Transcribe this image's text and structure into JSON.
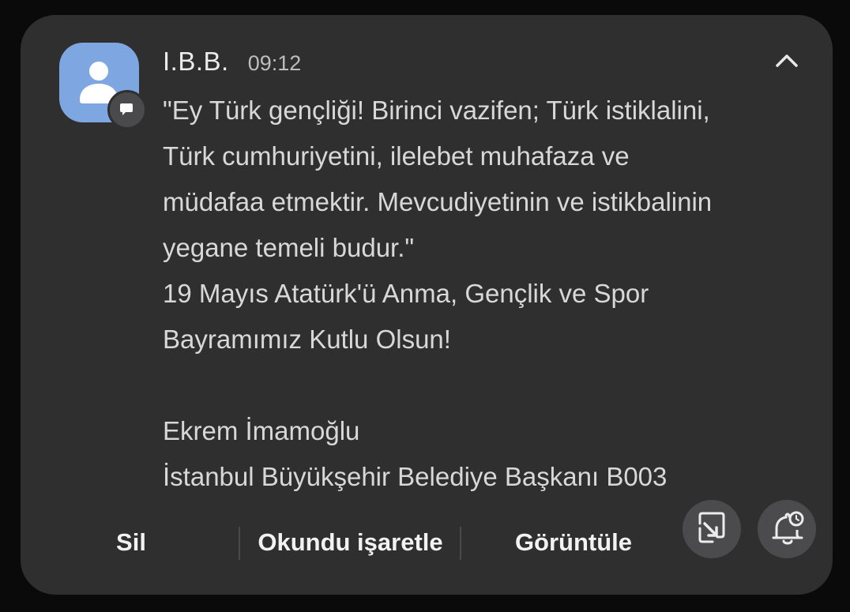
{
  "notification": {
    "sender": "I.B.B.",
    "time": "09:12",
    "message": "\"Ey Türk gençliği! Birinci vazifen; Türk istiklalini,\nTürk cumhuriyetini, ilelebet muhafaza ve\nmüdafaa etmektir. Mevcudiyetinin ve istikbalinin\nyegane temeli budur.\"\n19 Mayıs Atatürk'ü Anma, Gençlik ve Spor\nBayramımız Kutlu Olsun!\n\nEkrem İmamoğlu\nİstanbul Büyükşehir Belediye Başkanı B003",
    "avatar_icon": "person-icon",
    "badge_icon": "message-bubble-icon",
    "collapse_icon": "chevron-up-icon"
  },
  "actions": {
    "delete_label": "Sil",
    "mark_read_label": "Okundu işaretle",
    "view_label": "Görüntüle",
    "open_icon": "open-in-popup-icon",
    "snooze_icon": "snooze-bell-icon"
  },
  "colors": {
    "card_bg": "#2f2f30",
    "avatar_bg": "#7ea7e2",
    "text_primary": "#ececec",
    "text_secondary": "#d8d8d8"
  }
}
